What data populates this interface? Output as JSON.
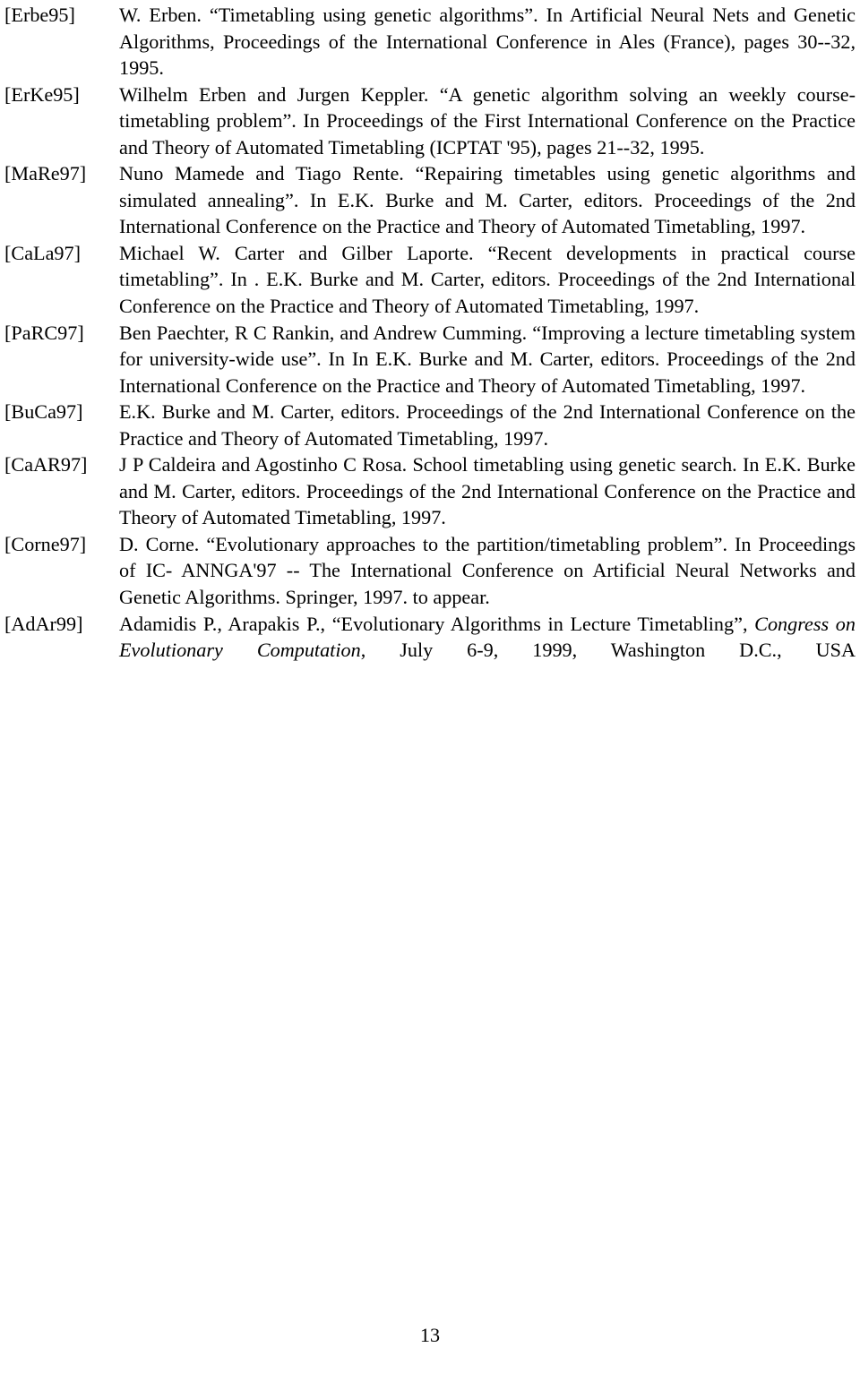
{
  "document": {
    "type": "bibliography",
    "page_number": "13",
    "references": [
      {
        "label": "[Erbe95]",
        "text": "W. Erben. “Timetabling using genetic algorithms”. In Artificial Neural Nets and Genetic Algorithms, Proceedings of the International Conference in Ales (France), pages 30--32, 1995."
      },
      {
        "label": "[ErKe95]",
        "text": "Wilhelm Erben and Jurgen Keppler. “A genetic algorithm solving an weekly course-timetabling problem”. In Proceedings of the First International Conference on the Practice and Theory of Automated Timetabling (ICPTAT '95), pages 21--32, 1995."
      },
      {
        "label": "[MaRe97]",
        "text": "Nuno Mamede and Tiago Rente. “Repairing timetables using genetic algorithms and simulated annealing”. In E.K. Burke and M. Carter, editors. Proceedings of the 2nd International Conference on the Practice and Theory of Automated Timetabling, 1997."
      },
      {
        "label": "[CaLa97]",
        "text": "Michael W. Carter and Gilber Laporte. “Recent developments in practical course timetabling”. In . E.K. Burke and M. Carter, editors. Proceedings of the 2nd International Conference on the Practice and Theory of Automated Timetabling, 1997."
      },
      {
        "label": "[PaRC97]",
        "text": "Ben Paechter, R C Rankin, and Andrew Cumming. “Improving a lecture timetabling system for university-wide use”. In In E.K. Burke and M. Carter, editors. Proceedings of the 2nd International Conference on the Practice and Theory of Automated Timetabling, 1997."
      },
      {
        "label": "[BuCa97]",
        "text": "E.K. Burke and M. Carter, editors. Proceedings of the 2nd International Conference on the Practice and Theory of Automated Timetabling, 1997."
      },
      {
        "label": "[CaAR97]",
        "text": "J P Caldeira and Agostinho C Rosa. School timetabling using genetic search. In E.K. Burke and M. Carter, editors. Proceedings of the 2nd International Conference on the Practice and Theory of Automated Timetabling, 1997."
      },
      {
        "label": "[Corne97]",
        "text": "D. Corne. “Evolutionary approaches to the partition/timetabling problem”. In Proceedings of IC- ANNGA'97 -- The International Conference on Artificial Neural Networks and Genetic Algorithms. Springer, 1997. to appear."
      },
      {
        "label": "[AdAr99]",
        "text_before_italic": "Adamidis P., Arapakis P., “Evolutionary Algorithms in Lecture Timetabling”, ",
        "italic_text": "Congress on Evolutionary Computation",
        "text_after_italic": ", July 6-9, 1999, Washington D.C., USA"
      }
    ]
  }
}
